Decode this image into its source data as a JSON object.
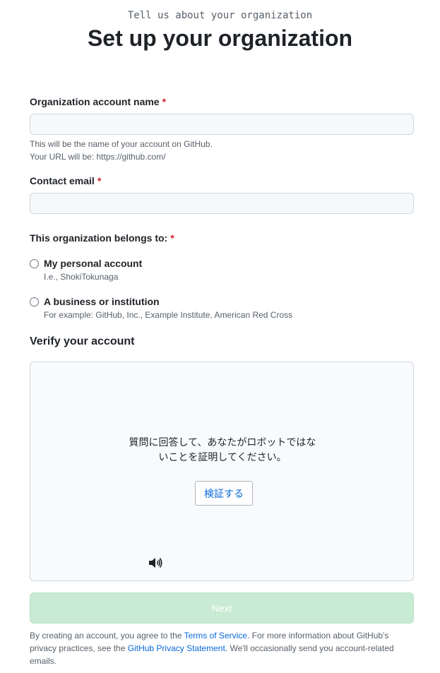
{
  "header": {
    "eyebrow": "Tell us about your organization",
    "title": "Set up your organization"
  },
  "form": {
    "org_name": {
      "label": "Organization account name",
      "required_mark": "*",
      "value": "",
      "note_line1": "This will be the name of your account on GitHub.",
      "note_line2": "Your URL will be: https://github.com/"
    },
    "contact_email": {
      "label": "Contact email",
      "required_mark": "*",
      "value": ""
    },
    "belongs_to": {
      "label": "This organization belongs to:",
      "required_mark": "*",
      "options": [
        {
          "title": "My personal account",
          "desc": "I.e., ShokiTokunaga"
        },
        {
          "title": "A business or institution",
          "desc": "For example: GitHub, Inc., Example Institute, American Red Cross"
        }
      ]
    }
  },
  "verify": {
    "title": "Verify your account",
    "line1": "質問に回答して、あなたがロボットではな",
    "line2": "いことを証明してください。",
    "button_label": "検証する",
    "audio_icon": "speaker-icon"
  },
  "next_label": "Next",
  "legal": {
    "prefix": "By creating an account, you agree to the ",
    "tos_link": "Terms of Service",
    "middle": ". For more information about GitHub's privacy practices, see the ",
    "privacy_link": "GitHub Privacy Statement",
    "suffix": ". We'll occasionally send you account-related emails."
  },
  "colors": {
    "required": "#cf222e",
    "link": "#0969da",
    "next_disabled_bg": "#c9ebd3"
  }
}
